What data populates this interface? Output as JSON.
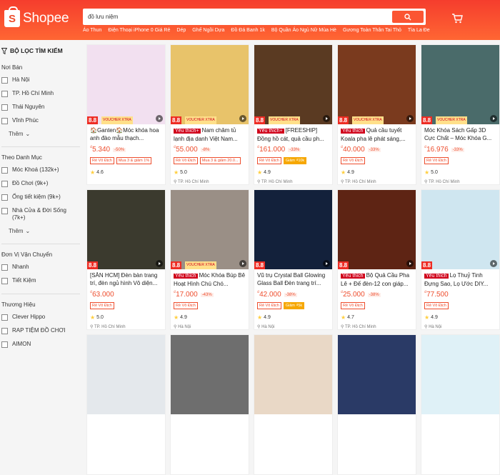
{
  "header": {
    "logo_text": "Shopee",
    "search_value": "đồ lưu niệm",
    "hints": [
      "Áo Thun",
      "Điện Thoại iPhone 0 Giá Rẻ",
      "Dép",
      "Ghế Ngồi Dựa",
      "Đồ Đá Banh 1k",
      "Bộ Quần Áo Ngủ Nữ Mùa Hè",
      "Gương Toàn Thân Tai Thỏ",
      "Tìa La Đe"
    ]
  },
  "sidebar": {
    "heading": "BỘ LỌC TÌM KIẾM",
    "groups": [
      {
        "title": "Nơi Bán",
        "options": [
          "Hà Nội",
          "TP. Hồ Chí Minh",
          "Thái Nguyên",
          "Vĩnh Phúc"
        ],
        "more": "Thêm"
      },
      {
        "title": "Theo Danh Mục",
        "options": [
          "Móc Khoá (132k+)",
          "Đồ Chơi (9k+)",
          "Ống tiết kiệm (9k+)",
          "Nhà Cửa & Đời Sống (7k+)"
        ],
        "more": "Thêm"
      },
      {
        "title": "Đơn Vị Vận Chuyển",
        "options": [
          "Nhanh",
          "Tiết Kiệm"
        ]
      },
      {
        "title": "Thương Hiệu",
        "options": [
          "Clever Hippo",
          "RAP TIỆM ĐỒ CHƠI",
          "AIMON"
        ]
      }
    ]
  },
  "badge_88": "8.8",
  "products": [
    {
      "title": "🏠Ganten🏠Móc khóa hoa anh đào mẫu thạch...",
      "fav": "",
      "price": "5.340",
      "disc": "-50%",
      "chips": [
        {
          "t": "Rẻ Vô Địch",
          "y": false
        },
        {
          "t": "Mua 3 & giảm 1%",
          "y": false
        }
      ],
      "rating": "4.6",
      "loc": "",
      "img": "#f2e0f0",
      "tag": "VOUCHER XTRA"
    },
    {
      "title": "Nam châm tủ lạnh địa danh Việt Nam...",
      "fav": "Yêu thích+",
      "price": "55.000",
      "disc": "-8%",
      "chips": [
        {
          "t": "Rẻ Vô Địch",
          "y": false
        },
        {
          "t": "Mua 3 & giảm 20.0...",
          "y": false
        }
      ],
      "rating": "5.0",
      "loc": "TP. Hồ Chí Minh",
      "img": "#e8c36a",
      "tag": "VOUCHER XTRA"
    },
    {
      "title": "[FREESHIP] Đồng hồ cát, quả cầu ph...",
      "fav": "Yêu thích+",
      "price": "161.000",
      "disc": "-33%",
      "chips": [
        {
          "t": "Rẻ Vô Địch",
          "y": false
        },
        {
          "t": "Giảm ₫10k",
          "y": true
        }
      ],
      "rating": "4.9",
      "loc": "TP. Hồ Chí Minh",
      "img": "#5a3a22",
      "tag": "VOUCHER XTRA"
    },
    {
      "title": "Quả cầu tuyết Koala pha lê phát sáng,...",
      "fav": "Yêu thích",
      "price": "40.000",
      "disc": "-33%",
      "chips": [
        {
          "t": "Rẻ Vô Địch",
          "y": false
        }
      ],
      "rating": "4.9",
      "loc": "TP. Hồ Chí Minh",
      "img": "#7a3a1e",
      "tag": "VOUCHER XTRA"
    },
    {
      "title": "Móc Khóa Sách Gấp 3D Cực Chất – Móc Khóa G...",
      "fav": "",
      "price": "16.976",
      "disc": "-33%",
      "chips": [
        {
          "t": "Rẻ Vô Địch",
          "y": false
        }
      ],
      "rating": "5.0",
      "loc": "TP. Hồ Chí Minh",
      "img": "#4a6b6a",
      "tag": "VOUCHER XTRA"
    },
    {
      "title": "[SẴN HCM] Đèn bàn trang trí, đèn ngủ hình Vô diện...",
      "fav": "",
      "price": "63.000",
      "disc": "",
      "chips": [
        {
          "t": "Rẻ Vô Địch",
          "y": false
        }
      ],
      "rating": "5.0",
      "loc": "TP. Hồ Chí Minh",
      "img": "#3b3a2e",
      "tag": ""
    },
    {
      "title": "Móc Khóa Búp Bê Hoạt Hình Chú Chó...",
      "fav": "Yêu thích",
      "price": "17.000",
      "disc": "-43%",
      "chips": [
        {
          "t": "Rẻ Vô Địch",
          "y": false
        }
      ],
      "rating": "4.9",
      "loc": "Hà Nội",
      "img": "#9a8f86",
      "tag": "VOUCHER XTRA"
    },
    {
      "title": "Vũ trụ Crystal Ball Glowing Glass Ball Đèn trang trí...",
      "fav": "",
      "price": "42.000",
      "disc": "-38%",
      "chips": [
        {
          "t": "Rẻ Vô Địch",
          "y": false
        },
        {
          "t": "Giảm ₫5k",
          "y": true
        }
      ],
      "rating": "4.9",
      "loc": "Hà Nội",
      "img": "#13213b",
      "tag": ""
    },
    {
      "title": "Bộ Quả Cầu Pha Lê + Đế đèn-12 con giáp...",
      "fav": "Yêu thích",
      "price": "25.000",
      "disc": "-38%",
      "chips": [
        {
          "t": "Rẻ Vô Địch",
          "y": false
        }
      ],
      "rating": "4.7",
      "loc": "TP. Hồ Chí Minh",
      "img": "#5e2414",
      "tag": ""
    },
    {
      "title": "Lọ Thuỷ Tinh Đựng Sao, Lọ Ước DIY...",
      "fav": "Yêu thích",
      "price": "77.500",
      "disc": "",
      "chips": [
        {
          "t": "Rẻ Vô Địch",
          "y": false
        }
      ],
      "rating": "4.9",
      "loc": "Hà Nội",
      "img": "#cfe6f0",
      "tag": ""
    },
    {
      "title": "",
      "fav": "",
      "price": "",
      "disc": "",
      "chips": [],
      "rating": "",
      "loc": "",
      "img": "#e4e8ec",
      "tag": ""
    },
    {
      "title": "",
      "fav": "",
      "price": "",
      "disc": "",
      "chips": [],
      "rating": "",
      "loc": "",
      "img": "#6e6e6e",
      "tag": ""
    },
    {
      "title": "",
      "fav": "",
      "price": "",
      "disc": "",
      "chips": [],
      "rating": "",
      "loc": "",
      "img": "#e9d8c6",
      "tag": ""
    },
    {
      "title": "",
      "fav": "",
      "price": "",
      "disc": "",
      "chips": [],
      "rating": "",
      "loc": "",
      "img": "#2a3a66",
      "tag": ""
    },
    {
      "title": "",
      "fav": "",
      "price": "",
      "disc": "",
      "chips": [],
      "rating": "",
      "loc": "",
      "img": "#dff1f7",
      "tag": ""
    }
  ],
  "currency": "₫",
  "star_glyph": "★",
  "pin_glyph": "⚲",
  "colors": {
    "brand": "#ee4d2d"
  }
}
